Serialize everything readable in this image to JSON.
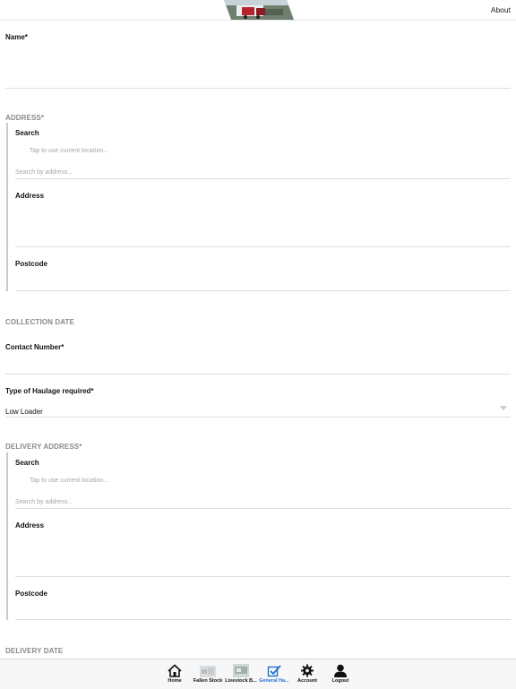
{
  "header": {
    "about_label": "About"
  },
  "form": {
    "name_label": "Name*",
    "address_section": "ADDRESS*",
    "address_search_label": "Search",
    "address_location_hint": "Tap to use current location...",
    "address_search_placeholder": "Search by address...",
    "address_label": "Address",
    "postcode_label": "Postcode",
    "collection_date_section": "COLLECTION DATE",
    "contact_number_label": "Contact Number*",
    "haulage_type_label": "Type of Haulage required*",
    "haulage_type_value": "Low Loader",
    "delivery_address_section": "DELIVERY ADDRESS*",
    "delivery_search_label": "Search",
    "delivery_location_hint": "Tap to use current location...",
    "delivery_search_placeholder": "Search by address...",
    "delivery_address_label": "Address",
    "delivery_postcode_label": "Postcode",
    "delivery_date_section": "DELIVERY DATE"
  },
  "tabbar": {
    "active_color": "#1f6fd1",
    "items": [
      {
        "label": "Home",
        "icon": "home-icon"
      },
      {
        "label": "Fallen Stock",
        "icon": "fallen-stock-thumbnail"
      },
      {
        "label": "Livestock B...",
        "icon": "livestock-thumbnail"
      },
      {
        "label": "General Ha...",
        "icon": "checkmark-icon",
        "active": true
      },
      {
        "label": "Account",
        "icon": "gear-icon"
      },
      {
        "label": "Logout",
        "icon": "person-icon"
      }
    ]
  }
}
